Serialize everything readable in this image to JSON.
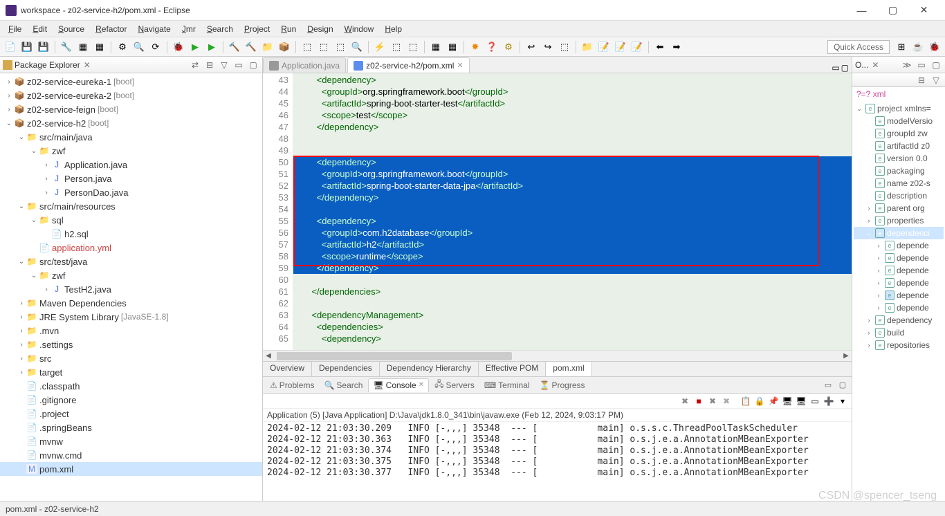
{
  "title": "workspace - z02-service-h2/pom.xml - Eclipse",
  "menu": [
    "File",
    "Edit",
    "Source",
    "Refactor",
    "Navigate",
    "Jmr",
    "Search",
    "Project",
    "Run",
    "Design",
    "Window",
    "Help"
  ],
  "quickAccess": "Quick Access",
  "pkgExplorer": {
    "title": "Package Explorer",
    "tree": [
      {
        "d": 0,
        "a": ">",
        "ic": "ic-proj",
        "t": "z02-service-eureka-1",
        "tag": "[boot]"
      },
      {
        "d": 0,
        "a": ">",
        "ic": "ic-proj",
        "t": "z02-service-eureka-2",
        "tag": "[boot]"
      },
      {
        "d": 0,
        "a": ">",
        "ic": "ic-proj",
        "t": "z02-service-feign",
        "tag": "[boot]"
      },
      {
        "d": 0,
        "a": "v",
        "ic": "ic-proj",
        "t": "z02-service-h2",
        "tag": "[boot]"
      },
      {
        "d": 1,
        "a": "v",
        "ic": "ic-pkg",
        "t": "src/main/java"
      },
      {
        "d": 2,
        "a": "v",
        "ic": "ic-pkg",
        "t": "zwf"
      },
      {
        "d": 3,
        "a": ">",
        "ic": "ic-java",
        "t": "Application.java"
      },
      {
        "d": 3,
        "a": ">",
        "ic": "ic-java",
        "t": "Person.java"
      },
      {
        "d": 3,
        "a": ">",
        "ic": "ic-java",
        "t": "PersonDao.java"
      },
      {
        "d": 1,
        "a": "v",
        "ic": "ic-pkg",
        "t": "src/main/resources"
      },
      {
        "d": 2,
        "a": "v",
        "ic": "ic-folder",
        "t": "sql"
      },
      {
        "d": 3,
        "a": "",
        "ic": "ic-file",
        "t": "h2.sql"
      },
      {
        "d": 2,
        "a": "",
        "ic": "ic-file",
        "t": "application.yml",
        "style": "color:#c44"
      },
      {
        "d": 1,
        "a": "v",
        "ic": "ic-pkg",
        "t": "src/test/java"
      },
      {
        "d": 2,
        "a": "v",
        "ic": "ic-pkg",
        "t": "zwf"
      },
      {
        "d": 3,
        "a": ">",
        "ic": "ic-java",
        "t": "TestH2.java"
      },
      {
        "d": 1,
        "a": ">",
        "ic": "ic-folder",
        "t": "Maven Dependencies"
      },
      {
        "d": 1,
        "a": ">",
        "ic": "ic-folder",
        "t": "JRE System Library",
        "tag": "[JavaSE-1.8]"
      },
      {
        "d": 1,
        "a": ">",
        "ic": "ic-folder",
        "t": ".mvn"
      },
      {
        "d": 1,
        "a": ">",
        "ic": "ic-folder",
        "t": ".settings"
      },
      {
        "d": 1,
        "a": ">",
        "ic": "ic-folder",
        "t": "src"
      },
      {
        "d": 1,
        "a": ">",
        "ic": "ic-folder",
        "t": "target"
      },
      {
        "d": 1,
        "a": "",
        "ic": "ic-file",
        "t": ".classpath"
      },
      {
        "d": 1,
        "a": "",
        "ic": "ic-file",
        "t": ".gitignore"
      },
      {
        "d": 1,
        "a": "",
        "ic": "ic-file",
        "t": ".project"
      },
      {
        "d": 1,
        "a": "",
        "ic": "ic-file",
        "t": ".springBeans"
      },
      {
        "d": 1,
        "a": "",
        "ic": "ic-file",
        "t": "mvnw"
      },
      {
        "d": 1,
        "a": "",
        "ic": "ic-file",
        "t": "mvnw.cmd"
      },
      {
        "d": 1,
        "a": "",
        "ic": "ic-xml",
        "t": "pom.xml",
        "sel": true
      }
    ]
  },
  "editorTabs": [
    {
      "label": "Application.java",
      "active": false
    },
    {
      "label": "z02-service-h2/pom.xml",
      "active": true
    }
  ],
  "codeLines": [
    {
      "n": 43,
      "s": 0,
      "h": "      <span class=tag-c>&lt;dependency&gt;</span>"
    },
    {
      "n": 44,
      "s": 0,
      "h": "        <span class=tag-c>&lt;groupId&gt;</span>org.springframework.boot<span class=tag-c>&lt;/groupId&gt;</span>"
    },
    {
      "n": 45,
      "s": 0,
      "h": "        <span class=tag-c>&lt;artifactId&gt;</span>spring-boot-starter-test<span class=tag-c>&lt;/artifactId&gt;</span>"
    },
    {
      "n": 46,
      "s": 0,
      "h": "        <span class=tag-c>&lt;scope&gt;</span>test<span class=tag-c>&lt;/scope&gt;</span>"
    },
    {
      "n": 47,
      "s": 0,
      "h": "      <span class=tag-c>&lt;/dependency&gt;</span>"
    },
    {
      "n": 48,
      "s": 0,
      "h": ""
    },
    {
      "n": 49,
      "s": 0,
      "h": ""
    },
    {
      "n": 50,
      "s": 1,
      "h": "      <span class=tag-c>&lt;dependency&gt;</span>"
    },
    {
      "n": 51,
      "s": 1,
      "h": "        <span class=tag-c>&lt;groupId&gt;</span>org.springframework.boot<span class=tag-c>&lt;/groupId&gt;</span>"
    },
    {
      "n": 52,
      "s": 1,
      "h": "        <span class=tag-c>&lt;artifactId&gt;</span>spring-boot-starter-data-jpa<span class=tag-c>&lt;/artifactId&gt;</span>"
    },
    {
      "n": 53,
      "s": 1,
      "h": "      <span class=tag-c>&lt;/dependency&gt;</span>"
    },
    {
      "n": 54,
      "s": 1,
      "h": ""
    },
    {
      "n": 55,
      "s": 1,
      "h": "      <span class=tag-c>&lt;dependency&gt;</span>"
    },
    {
      "n": 56,
      "s": 1,
      "h": "        <span class=tag-c>&lt;groupId&gt;</span>com.h2database<span class=tag-c>&lt;/groupId&gt;</span>"
    },
    {
      "n": 57,
      "s": 1,
      "h": "        <span class=tag-c>&lt;artifactId&gt;</span>h2<span class=tag-c>&lt;/artifactId&gt;</span>"
    },
    {
      "n": 58,
      "s": 1,
      "h": "        <span class=tag-c>&lt;scope&gt;</span>runtime<span class=tag-c>&lt;/scope&gt;</span>"
    },
    {
      "n": 59,
      "s": 1,
      "h": "      <span class=tag-c>&lt;/dependency&gt;</span>"
    },
    {
      "n": 60,
      "s": 0,
      "h": ""
    },
    {
      "n": 61,
      "s": 0,
      "h": "    <span class=tag-c>&lt;/dependencies&gt;</span>"
    },
    {
      "n": 62,
      "s": 0,
      "h": ""
    },
    {
      "n": 63,
      "s": 0,
      "h": "    <span class=tag-c>&lt;dependencyManagement&gt;</span>"
    },
    {
      "n": 64,
      "s": 0,
      "h": "      <span class=tag-c>&lt;dependencies&gt;</span>"
    },
    {
      "n": 65,
      "s": 0,
      "h": "        <span class=tag-c>&lt;dependency&gt;</span>"
    }
  ],
  "editorBottomTabs": [
    "Overview",
    "Dependencies",
    "Dependency Hierarchy",
    "Effective POM",
    "pom.xml"
  ],
  "editorBottomActive": "pom.xml",
  "bottomTabs": [
    {
      "label": "Problems"
    },
    {
      "label": "Search"
    },
    {
      "label": "Console",
      "active": true
    },
    {
      "label": "Servers"
    },
    {
      "label": "Terminal"
    },
    {
      "label": "Progress"
    }
  ],
  "consoleHeader": "Application (5) [Java Application] D:\\Java\\jdk1.8.0_341\\bin\\javaw.exe (Feb 12, 2024, 9:03:17 PM)",
  "consoleLines": [
    "2024-02-12 21:03:30.209   INFO [-,,,] 35348  --- [           main] o.s.s.c.ThreadPoolTaskScheduler",
    "2024-02-12 21:03:30.363   INFO [-,,,] 35348  --- [           main] o.s.j.e.a.AnnotationMBeanExporter",
    "2024-02-12 21:03:30.374   INFO [-,,,] 35348  --- [           main] o.s.j.e.a.AnnotationMBeanExporter",
    "2024-02-12 21:03:30.375   INFO [-,,,] 35348  --- [           main] o.s.j.e.a.AnnotationMBeanExporter",
    "2024-02-12 21:03:30.377   INFO [-,,,] 35348  --- [           main] o.s.j.e.a.AnnotationMBeanExporter"
  ],
  "outline": {
    "title": "O...",
    "header": "?=? xml",
    "items": [
      {
        "d": 0,
        "a": "v",
        "t": "project xmlns="
      },
      {
        "d": 1,
        "a": "",
        "t": "modelVersio"
      },
      {
        "d": 1,
        "a": "",
        "t": "groupId  zw"
      },
      {
        "d": 1,
        "a": "",
        "t": "artifactId  z0"
      },
      {
        "d": 1,
        "a": "",
        "t": "version  0.0"
      },
      {
        "d": 1,
        "a": "",
        "t": "packaging"
      },
      {
        "d": 1,
        "a": "",
        "t": "name  z02-s"
      },
      {
        "d": 1,
        "a": "",
        "t": "description"
      },
      {
        "d": 1,
        "a": ">",
        "t": "parent  org"
      },
      {
        "d": 1,
        "a": ">",
        "t": "properties"
      },
      {
        "d": 1,
        "a": "v",
        "t": "dependenci",
        "sel": true
      },
      {
        "d": 2,
        "a": ">",
        "t": "depende"
      },
      {
        "d": 2,
        "a": ">",
        "t": "depende"
      },
      {
        "d": 2,
        "a": ">",
        "t": "depende"
      },
      {
        "d": 2,
        "a": ">",
        "t": "depende"
      },
      {
        "d": 2,
        "a": ">",
        "t": "depende",
        "hl": true
      },
      {
        "d": 2,
        "a": ">",
        "t": "depende"
      },
      {
        "d": 1,
        "a": ">",
        "t": "dependency"
      },
      {
        "d": 1,
        "a": ">",
        "t": "build"
      },
      {
        "d": 1,
        "a": ">",
        "t": "repositories"
      }
    ]
  },
  "status": "pom.xml - z02-service-h2",
  "watermark": "CSDN @spencer_tseng"
}
